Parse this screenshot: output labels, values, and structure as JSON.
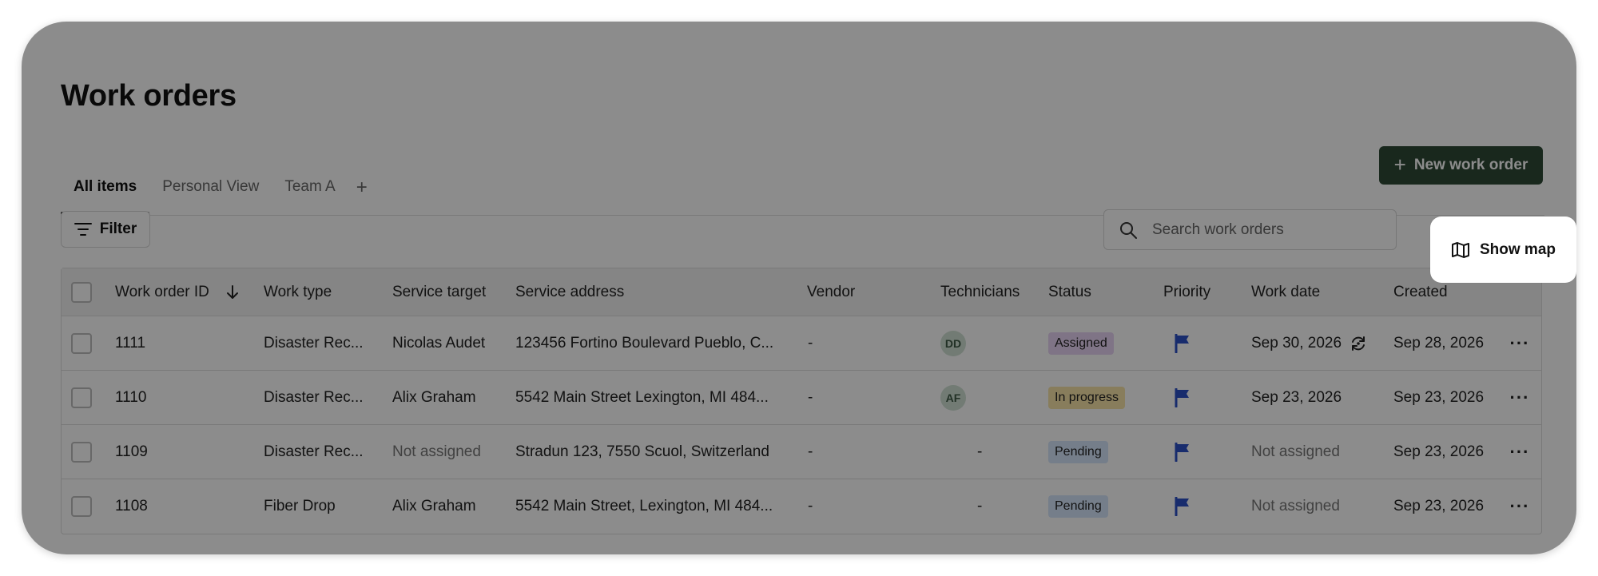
{
  "page": {
    "title": "Work orders"
  },
  "tabs": {
    "items": [
      {
        "label": "All items",
        "active": true
      },
      {
        "label": "Personal View",
        "active": false
      },
      {
        "label": "Team A",
        "active": false
      }
    ],
    "add_label": "+"
  },
  "toolbar": {
    "new_work_order_label": "New work order",
    "filter_label": "Filter",
    "search_placeholder": "Search work orders",
    "show_map_label": "Show map"
  },
  "table": {
    "columns": [
      "Work order ID",
      "Work type",
      "Service target",
      "Service address",
      "Vendor",
      "Technicians",
      "Status",
      "Priority",
      "Work date",
      "Created"
    ],
    "rows": [
      {
        "id": "1111",
        "work_type": "Disaster Rec...",
        "service_target": "Nicolas Audet",
        "service_address": "123456 Fortino Boulevard Pueblo, C...",
        "vendor": "-",
        "technicians": "DD",
        "status": "Assigned",
        "work_date": "Sep 30, 2026",
        "created": "Sep 28, 2026"
      },
      {
        "id": "1110",
        "work_type": "Disaster Rec...",
        "service_target": "Alix Graham",
        "service_address": "5542 Main Street Lexington, MI 484...",
        "vendor": "-",
        "technicians": "AF",
        "status": "In progress",
        "work_date": "Sep 23, 2026",
        "created": "Sep 23, 2026"
      },
      {
        "id": "1109",
        "work_type": "Disaster Rec...",
        "service_target": "Not assigned",
        "service_address": "Stradun 123, 7550 Scuol, Switzerland",
        "vendor": "-",
        "technicians": "-",
        "status": "Pending",
        "work_date": "Not assigned",
        "created": "Sep 23, 2026"
      },
      {
        "id": "1108",
        "work_type": "Fiber Drop",
        "service_target": "Alix Graham",
        "service_address": "5542 Main Street, Lexington, MI 484...",
        "vendor": "-",
        "technicians": "-",
        "status": "Pending",
        "work_date": "Not assigned",
        "created": "Sep 23, 2026"
      }
    ]
  },
  "colors": {
    "primary_button": "#2f4a36",
    "status_assigned": "#e8d3f4",
    "status_in_progress": "#f8e3a8",
    "status_pending": "#d6e6fb",
    "priority_flag": "#2c50c7"
  },
  "icons": [
    "plus-icon",
    "filter-icon",
    "search-icon",
    "map-icon",
    "sort-down-icon",
    "flag-icon",
    "recurring-icon",
    "more-icon"
  ]
}
